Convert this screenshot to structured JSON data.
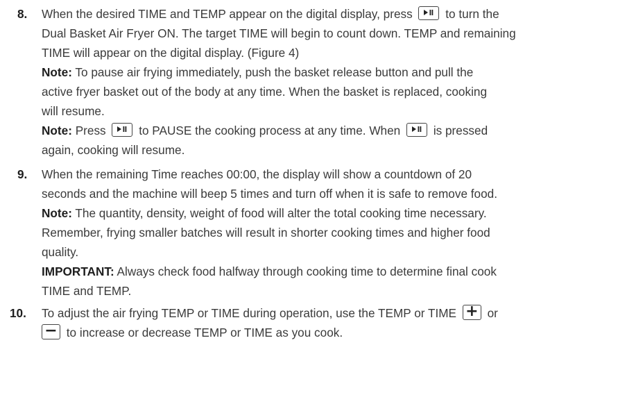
{
  "steps": [
    {
      "number": "8.",
      "lines": [
        {
          "pre": "When the desired TIME and TEMP appear on the digital display, press",
          "post": "to turn the"
        },
        {
          "text": "Dual Basket Air Fryer ON. The target TIME will begin to count down. TEMP and remaining"
        },
        {
          "text": "TIME will appear on the digital display. (Figure 4)"
        },
        {
          "bold": "Note:",
          "text": "To pause air frying immediately, push the basket release button and pull the"
        },
        {
          "text": "active fryer basket out of the body at any time. When the basket is replaced, cooking"
        },
        {
          "text": "will resume."
        },
        {
          "bold": "Note:",
          "pre": "Press",
          "mid": "to PAUSE the cooking process at any time. When",
          "post": "is pressed"
        },
        {
          "text": "again, cooking will resume."
        }
      ]
    },
    {
      "number": "9.",
      "lines": [
        {
          "text": "When the remaining Time reaches 00:00, the display will show a countdown of 20"
        },
        {
          "text": "seconds and the machine will beep 5 times and turn off when it is safe to remove food."
        },
        {
          "bold": "Note:",
          "text": "The quantity, density, weight of food will alter the total cooking time necessary."
        },
        {
          "text": "Remember, frying smaller batches will result in shorter cooking times and higher food"
        },
        {
          "text": "quality."
        },
        {
          "bold": "IMPORTANT:",
          "text": "Always check food halfway through cooking time to determine final cook"
        },
        {
          "text": "TIME and TEMP."
        }
      ]
    },
    {
      "number": "10.",
      "lines": [
        {
          "pre": "To adjust the air frying TEMP or TIME during operation, use the TEMP or TIME",
          "post": "or"
        },
        {
          "post": "to increase or decrease TEMP or TIME as you cook."
        }
      ]
    }
  ],
  "icons": {
    "play_pause": "play-pause-icon",
    "plus": "plus-icon",
    "minus": "minus-icon",
    "plus_glyph": "+",
    "minus_glyph": "−"
  }
}
